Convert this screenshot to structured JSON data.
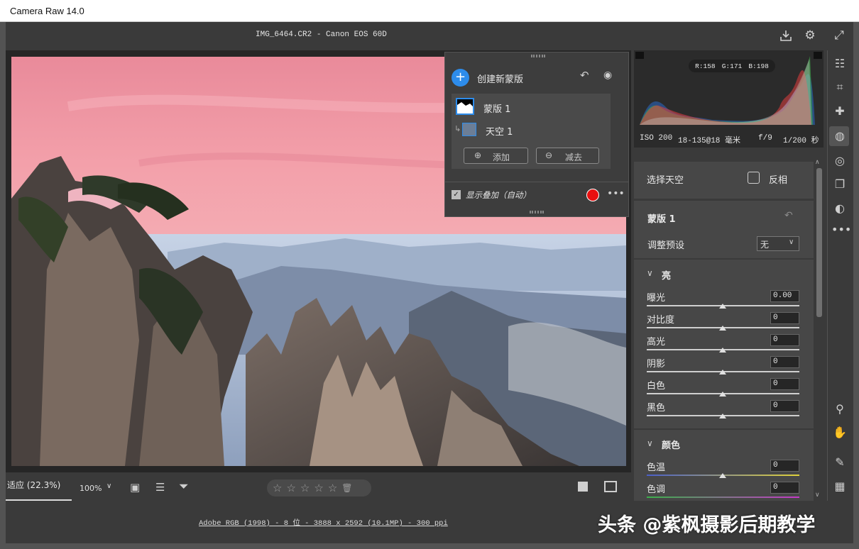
{
  "window": {
    "title": "Camera Raw 14.0"
  },
  "header": {
    "file": "IMG_6464.CR2 -  Canon EOS 60D"
  },
  "histogram": {
    "r": "R:158",
    "g": "G:171",
    "b": "B:198"
  },
  "exif": {
    "iso": "ISO 200",
    "lens": "18-135@18 毫米",
    "aperture": "f/9",
    "shutter": "1/200 秒"
  },
  "mask_panel": {
    "create_label": "创建新蒙版",
    "mask_name": "蒙版 1",
    "component_name": "天空 1",
    "add_label": "添加",
    "subtract_label": "减去",
    "overlay_label": "显示叠加（自动）",
    "overlay_checked": true,
    "overlay_color": "#e81010"
  },
  "panel": {
    "select_label": "选择天空",
    "invert_label": "反相",
    "mask_title": "蒙版 1",
    "preset_label": "调整预设",
    "preset_value": "无",
    "light_section": "亮",
    "color_section": "颜色",
    "sliders": [
      {
        "label": "曝光",
        "value": "0.00"
      },
      {
        "label": "对比度",
        "value": "0"
      },
      {
        "label": "高光",
        "value": "0"
      },
      {
        "label": "阴影",
        "value": "0"
      },
      {
        "label": "白色",
        "value": "0"
      },
      {
        "label": "黑色",
        "value": "0"
      }
    ],
    "color_sliders": [
      {
        "label": "色温",
        "value": "0"
      },
      {
        "label": "色调",
        "value": "0"
      }
    ]
  },
  "bottom": {
    "zoom_fit": "适应 (22.3%)",
    "zoom_value": "100%",
    "file_info": "Adobe RGB (1998) - 8 位 - 3888 x 2592 (10.1MP) - 300 ppi",
    "stars": [
      "☆",
      "☆",
      "☆",
      "☆",
      "☆"
    ]
  },
  "watermark": "头条 @紫枫摄影后期教学",
  "colors": {
    "accent": "#2d8ceb",
    "panel": "#3a3a3a",
    "sky_overlay": "#f0a0a8"
  }
}
